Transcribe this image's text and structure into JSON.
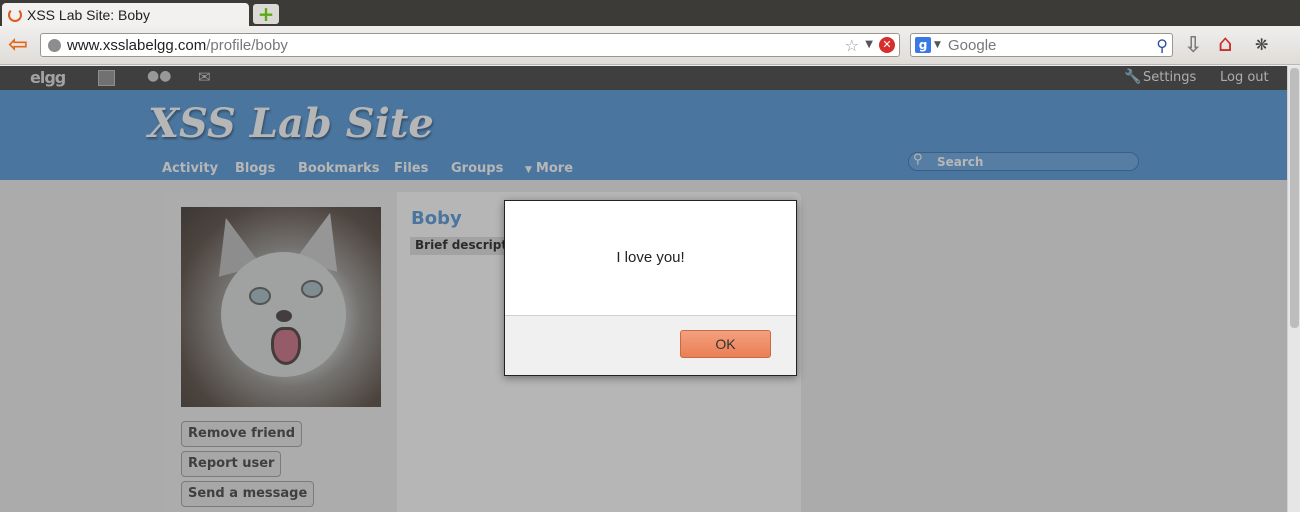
{
  "browser": {
    "tab_title": "XSS Lab Site: Boby",
    "new_tab_glyph": "+",
    "url_host": "www.xsslabelgg.com",
    "url_path": "/profile/boby",
    "search_placeholder": "Google",
    "search_engine_letter": "g"
  },
  "topbar": {
    "logo": "elgg",
    "settings_label": "Settings",
    "logout_label": "Log out"
  },
  "header": {
    "site_title": "XSS Lab Site",
    "menu": [
      "Activity",
      "Blogs",
      "Bookmarks",
      "Files",
      "Groups",
      "More"
    ],
    "search_placeholder": "Search"
  },
  "profile": {
    "name": "Boby",
    "brief_description_label": "Brief description:",
    "actions": [
      "Remove friend",
      "Report user",
      "Send a message"
    ]
  },
  "alert": {
    "message": "I love you!",
    "ok_label": "OK"
  },
  "colors": {
    "header_blue": "#4690d6",
    "ok_button": "#ea7f55",
    "link_blue": "#4690d6"
  },
  "icons": {
    "back": "back-arrow-icon",
    "globe": "globe-icon",
    "bookmark_star": "star-icon",
    "stop": "stop-icon",
    "download": "download-icon",
    "home": "home-icon",
    "addon": "addon-icon",
    "friends": "friends-icon",
    "messages": "mail-icon",
    "settings": "wrench-icon",
    "site_search": "search-icon"
  }
}
